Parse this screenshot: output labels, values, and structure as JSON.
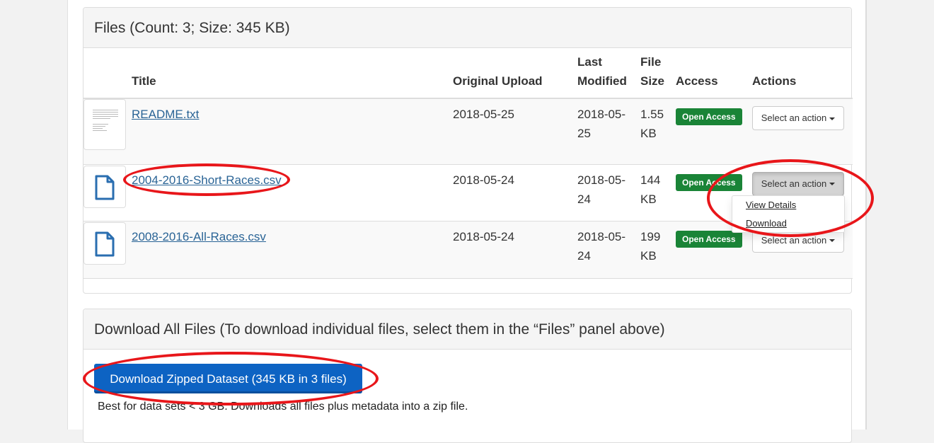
{
  "files_panel": {
    "heading": "Files (Count: 3; Size: 345 KB)",
    "columns": {
      "title": "Title",
      "original_upload": "Original Upload",
      "last_modified_line1": "Last",
      "last_modified_line2": "Modified",
      "file_size_line1": "File",
      "file_size_line2": "Size",
      "access": "Access",
      "actions": "Actions"
    },
    "rows": [
      {
        "thumbnail": "text-document-preview",
        "title": "README.txt",
        "original_upload": "2018-05-25",
        "last_modified_line1": "2018-05-",
        "last_modified_line2": "25",
        "size_line1": "1.55",
        "size_line2": "KB",
        "access": "Open Access",
        "action_label": "Select an action"
      },
      {
        "thumbnail": "file-icon",
        "title": "2004-2016-Short-Races.csv",
        "original_upload": "2018-05-24",
        "last_modified_line1": "2018-05-",
        "last_modified_line2": "24",
        "size_line1": "144",
        "size_line2": "KB",
        "access": "Open Access",
        "action_label": "Select an action",
        "dropdown_open": true
      },
      {
        "thumbnail": "file-icon",
        "title": "2008-2016-All-Races.csv",
        "original_upload": "2018-05-24",
        "last_modified_line1": "2018-05-",
        "last_modified_line2": "24",
        "size_line1": "199",
        "size_line2": "KB",
        "access": "Open Access",
        "action_label": "Select an action"
      }
    ],
    "dropdown_menu": {
      "items": [
        "View Details",
        "Download"
      ]
    }
  },
  "download_panel": {
    "heading": "Download All Files (To download individual files, select them in the “Files” panel above)",
    "button_label": "Download Zipped Dataset (345 KB in 3 files)",
    "help_text": "Best for data sets < 3 GB. Downloads all files plus metadata into a zip file."
  },
  "colors": {
    "badge_green": "#1a8437",
    "primary_blue": "#0d63c3",
    "link_blue": "#2a6496",
    "annotation_red": "#e8161a"
  }
}
